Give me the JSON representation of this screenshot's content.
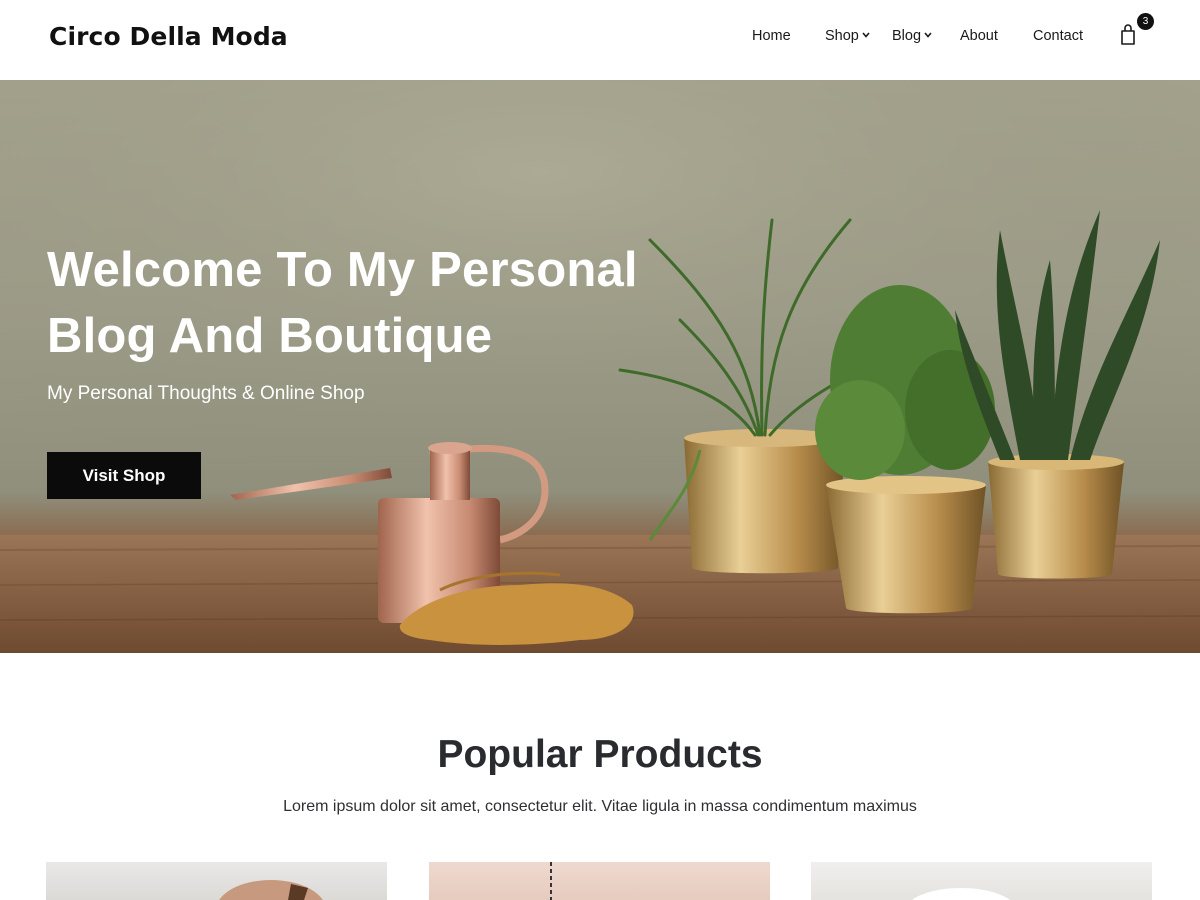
{
  "header": {
    "brand": "Circo Della Moda",
    "nav": [
      {
        "label": "Home"
      },
      {
        "label": "Shop"
      },
      {
        "label": "Blog"
      },
      {
        "label": "About"
      },
      {
        "label": "Contact"
      }
    ],
    "cart_count": "3"
  },
  "hero": {
    "title": "Welcome To My Personal Blog And Boutique",
    "subtitle": "My Personal Thoughts & Online Shop",
    "button_label": "Visit Shop"
  },
  "products": {
    "title": "Popular Products",
    "subtitle": "Lorem ipsum dolor sit amet, consectetur elit. Vitae ligula in massa condimentum maximus"
  },
  "colors": {
    "button_bg": "#0b0b0b",
    "hero_text": "#ffffff",
    "heading": "#2a2b2f"
  },
  "icons": [
    "cart-icon",
    "chevron-down-icon"
  ]
}
